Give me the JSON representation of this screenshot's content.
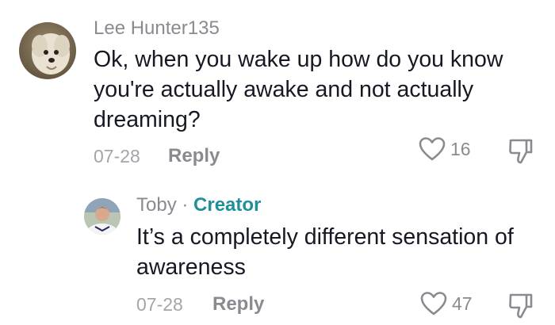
{
  "comments": [
    {
      "username": "Lee Hunter135",
      "text": "Ok, when you wake up how do you know you're actually awake and not actually dreaming?",
      "date": "07-28",
      "reply_label": "Reply",
      "likes": "16",
      "avatar_icon": "dog-avatar-icon"
    }
  ],
  "reply": {
    "username": "Toby",
    "separator": " · ",
    "badge": "Creator",
    "text": "It’s a completely different sensation of awareness",
    "date": "07-28",
    "reply_label": "Reply",
    "likes": "47",
    "avatar_icon": "person-avatar-icon"
  },
  "colors": {
    "text": "#161823",
    "muted": "#8a8b91",
    "creator": "#1f8f9a"
  }
}
